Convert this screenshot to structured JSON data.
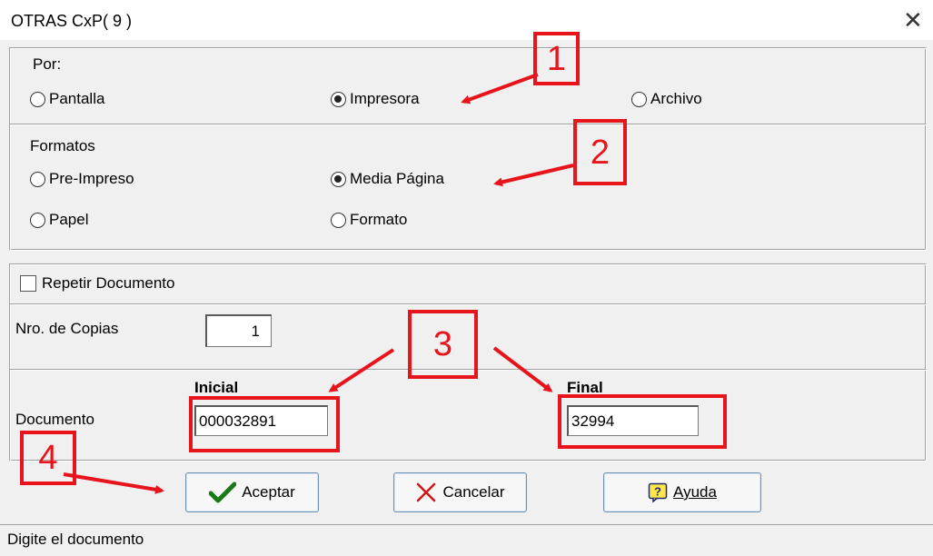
{
  "window": {
    "title": "OTRAS  CxP( 9 )",
    "close_glyph": "✕"
  },
  "por": {
    "label": "Por:",
    "options": [
      {
        "label": "Pantalla",
        "selected": false
      },
      {
        "label": "Impresora",
        "selected": true
      },
      {
        "label": "Archivo",
        "selected": false
      }
    ]
  },
  "formatos": {
    "label": "Formatos",
    "options": [
      {
        "label": "Pre-Impreso",
        "selected": false
      },
      {
        "label": "Media Página",
        "selected": true
      },
      {
        "label": "Papel",
        "selected": false
      },
      {
        "label": "Formato",
        "selected": false
      }
    ]
  },
  "repetir": {
    "label": "Repetir Documento",
    "checked": false
  },
  "copias": {
    "label": "Nro. de Copias",
    "value": "1"
  },
  "documento": {
    "label": "Documento",
    "inicial_label": "Inicial",
    "inicial_value": "000032891",
    "final_label": "Final",
    "final_value": "32994"
  },
  "buttons": {
    "accept": "Aceptar",
    "cancel": "Cancelar",
    "help": "Ayuda"
  },
  "status": {
    "text": "Digite el documento"
  },
  "annotations": {
    "n1": "1",
    "n2": "2",
    "n3": "3",
    "n4": "4"
  },
  "colors": {
    "annotation_red": "#e8141b",
    "dialog_bg": "#f0f0f0"
  }
}
